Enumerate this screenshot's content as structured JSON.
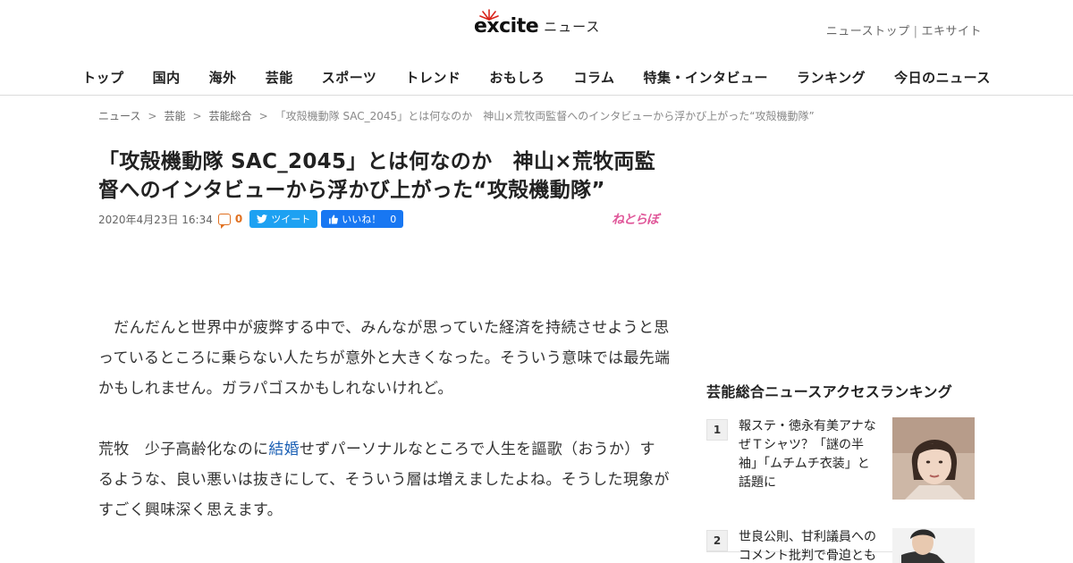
{
  "header": {
    "logo_text": "excite",
    "logo_sub": "ニュース",
    "top_links": [
      "ニューストップ",
      "エキサイト"
    ],
    "nav": [
      "トップ",
      "国内",
      "海外",
      "芸能",
      "スポーツ",
      "トレンド",
      "おもしろ",
      "コラム",
      "特集・インタビュー",
      "ランキング",
      "今日のニュース"
    ]
  },
  "breadcrumb": {
    "items": [
      "ニュース",
      "芸能",
      "芸能総合"
    ],
    "current": "「攻殻機動隊 SAC_2045」とは何なのか　神山×荒牧両監督へのインタビューから浮かび上がった“攻殻機動隊”"
  },
  "article": {
    "title": "「攻殻機動隊 SAC_2045」とは何なのか　神山×荒牧両監督へのインタビューから浮かび上がった“攻殻機動隊”",
    "date": "2020年4月23日 16:34",
    "comment_count": "0",
    "tweet_label": "ツイート",
    "like_label": "いいね！",
    "like_count": "0",
    "source": "ねとらぼ",
    "p1": "　だんだんと世界中が疲弊する中で、みんなが思っていた経済を持続させようと思っているところに乗らない人たちが意外と大きくなった。そういう意味では最先端かもしれません。ガラパゴスかもしれないけれど。",
    "p2_before": "荒牧　少子高齢化なのに",
    "p2_link": "結婚",
    "p2_after": "せずパーソナルなところで人生を謳歌（おうか）するような、良い悪いは抜きにして、そういう層は増えましたよね。そうした現象がすごく興味深く思えます。"
  },
  "sidebar": {
    "title": "芸能総合ニュースアクセスランキング",
    "items": [
      {
        "rank": "1",
        "text": "報ステ・徳永有美アナなぜＴシャツ？「謎の半袖」「ムチムチ衣装」と話題に"
      },
      {
        "rank": "2",
        "text": "世良公則、甘利議員へのコメント批判で骨迫とも"
      }
    ]
  },
  "colors": {
    "accent_orange": "#e07020",
    "tweet_blue": "#1da1f2",
    "like_blue": "#1877f2",
    "link_blue": "#1a5fb4",
    "source_pink": "#e0589a"
  }
}
